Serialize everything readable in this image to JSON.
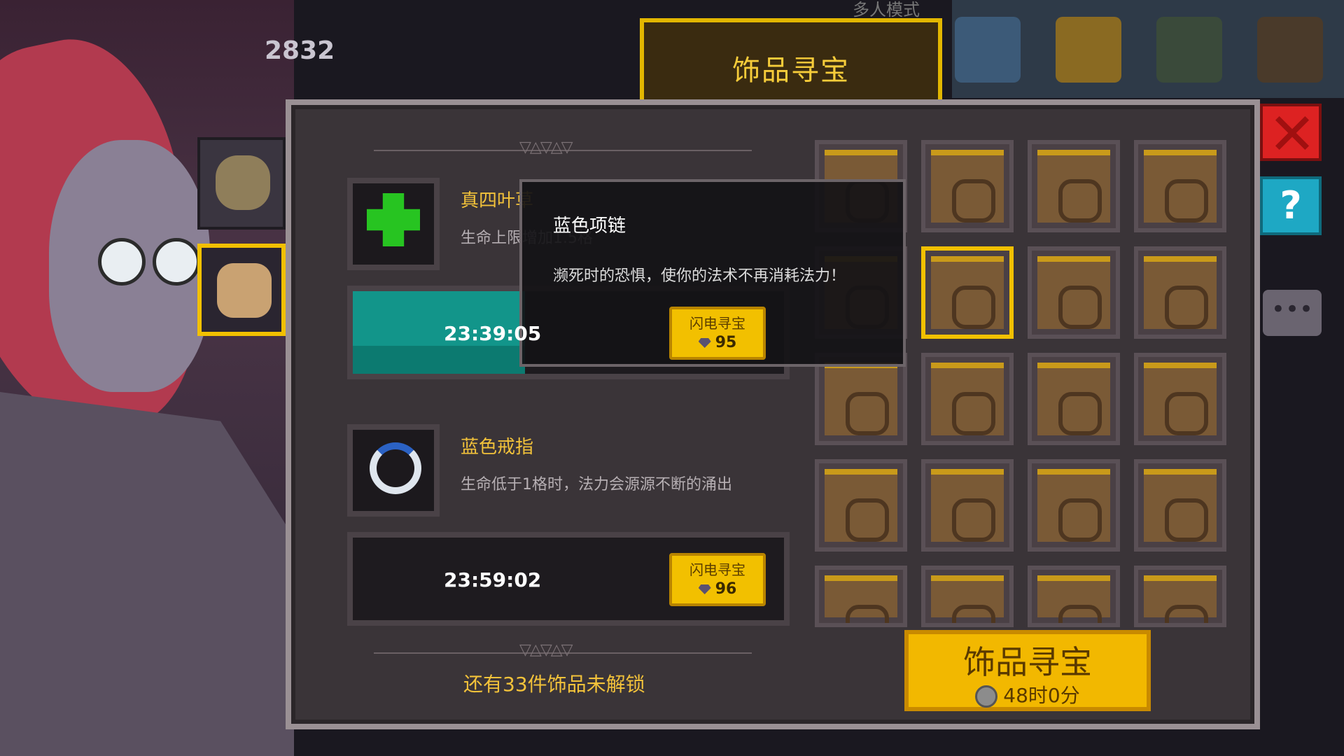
{
  "hud": {
    "currency": "2832",
    "mode_text": "多人模式"
  },
  "title_tab": "饰品寻宝",
  "list": [
    {
      "name": "真四叶草",
      "desc": "生命上限增加1.5格",
      "timer": "23:39:05",
      "progress": 0.4,
      "flash_label": "闪电寻宝",
      "flash_cost": "95",
      "icon": "clover-icon"
    },
    {
      "name": "蓝色戒指",
      "desc": "生命低于1格时，法力会源源不断的涌出",
      "timer": "23:59:02",
      "progress": 0,
      "flash_label": "闪电寻宝",
      "flash_cost": "96",
      "icon": "ring-icon"
    }
  ],
  "locked_text": "还有33件饰品未解锁",
  "tooltip": {
    "title": "蓝色项链",
    "desc": "濒死时的恐惧，使你的法术不再消耗法力！"
  },
  "big_button": {
    "label": "饰品寻宝",
    "time": "48时0分"
  },
  "colors": {
    "accent": "#f2c000",
    "panel": "#3a3438",
    "progress": "#12958a"
  }
}
